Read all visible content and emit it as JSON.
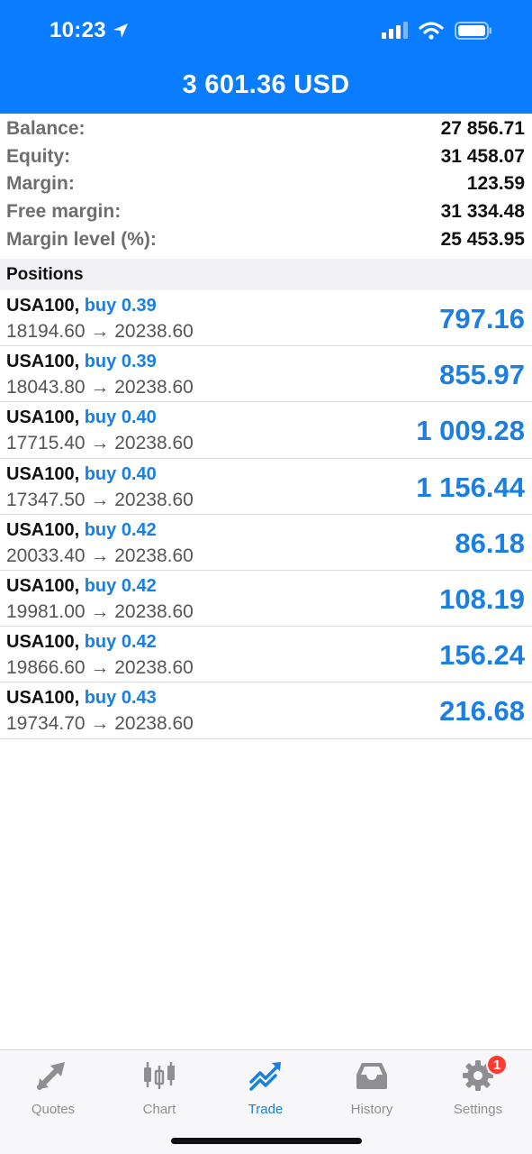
{
  "status": {
    "time": "10:23"
  },
  "header": {
    "title": "3 601.36 USD"
  },
  "summary": [
    {
      "label": "Balance:",
      "value": "27 856.71"
    },
    {
      "label": "Equity:",
      "value": "31 458.07"
    },
    {
      "label": "Margin:",
      "value": "123.59"
    },
    {
      "label": "Free margin:",
      "value": "31 334.48"
    },
    {
      "label": "Margin level (%):",
      "value": "25 453.95"
    }
  ],
  "section_title": "Positions",
  "positions": [
    {
      "symbol": "USA100,",
      "side": "buy 0.39",
      "prices": "18194.60 → 20238.60",
      "profit": "797.16"
    },
    {
      "symbol": "USA100,",
      "side": "buy 0.39",
      "prices": "18043.80 → 20238.60",
      "profit": "855.97"
    },
    {
      "symbol": "USA100,",
      "side": "buy 0.40",
      "prices": "17715.40 → 20238.60",
      "profit": "1 009.28"
    },
    {
      "symbol": "USA100,",
      "side": "buy 0.40",
      "prices": "17347.50 → 20238.60",
      "profit": "1 156.44"
    },
    {
      "symbol": "USA100,",
      "side": "buy 0.42",
      "prices": "20033.40 → 20238.60",
      "profit": "86.18"
    },
    {
      "symbol": "USA100,",
      "side": "buy 0.42",
      "prices": "19981.00 → 20238.60",
      "profit": "108.19"
    },
    {
      "symbol": "USA100,",
      "side": "buy 0.42",
      "prices": "19866.60 → 20238.60",
      "profit": "156.24"
    },
    {
      "symbol": "USA100,",
      "side": "buy 0.43",
      "prices": "19734.70 → 20238.60",
      "profit": "216.68"
    }
  ],
  "tabs": [
    {
      "label": "Quotes",
      "icon": "quotes-icon",
      "active": false
    },
    {
      "label": "Chart",
      "icon": "chart-candles-icon",
      "active": false
    },
    {
      "label": "Trade",
      "icon": "trade-icon",
      "active": true
    },
    {
      "label": "History",
      "icon": "history-inbox-icon",
      "active": false
    },
    {
      "label": "Settings",
      "icon": "gear-icon",
      "active": false,
      "badge": "1"
    }
  ],
  "colors": {
    "header_bg": "#0a7cff",
    "accent": "#1a7fe0",
    "badge": "#ff3b30"
  }
}
